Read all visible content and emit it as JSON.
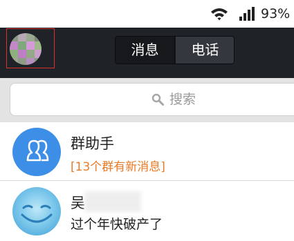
{
  "status_bar": {
    "battery": "93%",
    "wifi_icon": "wifi-icon",
    "signal_icon": "signal-bars-icon"
  },
  "header": {
    "tabs": [
      {
        "label": "消息",
        "selected": true
      },
      {
        "label": "电话",
        "selected": false
      }
    ],
    "colors": {
      "background": "#1f2226",
      "highlight_border": "#d9312b"
    }
  },
  "search": {
    "placeholder": "搜索",
    "icon": "search-icon"
  },
  "conversations": [
    {
      "title": "群助手",
      "subtitle": "[13个群有新消息]",
      "icon": "group-icon",
      "subtitle_color": "#ea7a26"
    },
    {
      "title": "吴",
      "subtitle": "过个年快破产了",
      "icon": "smiley-avatar"
    }
  ]
}
